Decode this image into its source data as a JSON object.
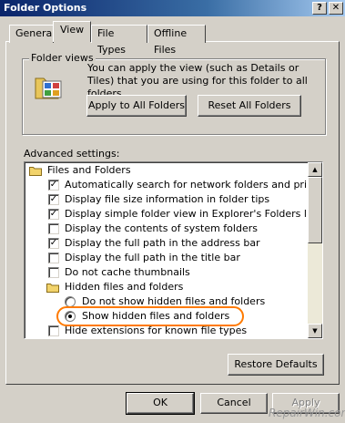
{
  "window": {
    "title": "Folder Options",
    "help_label": "?",
    "close_label": "✕"
  },
  "tabs": [
    {
      "label": "General"
    },
    {
      "label": "View",
      "active": true
    },
    {
      "label": "File Types"
    },
    {
      "label": "Offline Files"
    }
  ],
  "folder_views": {
    "group_label": "Folder views",
    "description": "You can apply the view (such as Details or Tiles) that you are using for this folder to all folders.",
    "apply_all_label": "Apply to All Folders",
    "reset_all_label": "Reset All Folders",
    "icon": "folder-views-icon"
  },
  "advanced": {
    "label": "Advanced settings:",
    "items": [
      {
        "type": "folder",
        "label": "Files and Folders"
      },
      {
        "type": "check",
        "checked": true,
        "label": "Automatically search for network folders and printers"
      },
      {
        "type": "check",
        "checked": true,
        "label": "Display file size information in folder tips"
      },
      {
        "type": "check",
        "checked": true,
        "label": "Display simple folder view in Explorer's Folders list"
      },
      {
        "type": "check",
        "checked": false,
        "label": "Display the contents of system folders"
      },
      {
        "type": "check",
        "checked": true,
        "label": "Display the full path in the address bar"
      },
      {
        "type": "check",
        "checked": false,
        "label": "Display the full path in the title bar"
      },
      {
        "type": "check",
        "checked": false,
        "label": "Do not cache thumbnails"
      },
      {
        "type": "folder",
        "label": "Hidden files and folders"
      },
      {
        "type": "radio",
        "selected": false,
        "label": "Do not show hidden files and folders"
      },
      {
        "type": "radio",
        "selected": true,
        "label": "Show hidden files and folders"
      },
      {
        "type": "check",
        "checked": false,
        "label": "Hide extensions for known file types"
      }
    ]
  },
  "restore_defaults_label": "Restore Defaults",
  "dialog_buttons": {
    "ok": "OK",
    "cancel": "Cancel",
    "apply": "Apply"
  },
  "watermark": "RepairWin.com",
  "colors": {
    "highlight": "#ff7a00",
    "titlebar_start": "#0a246a",
    "titlebar_end": "#a6caf0"
  }
}
